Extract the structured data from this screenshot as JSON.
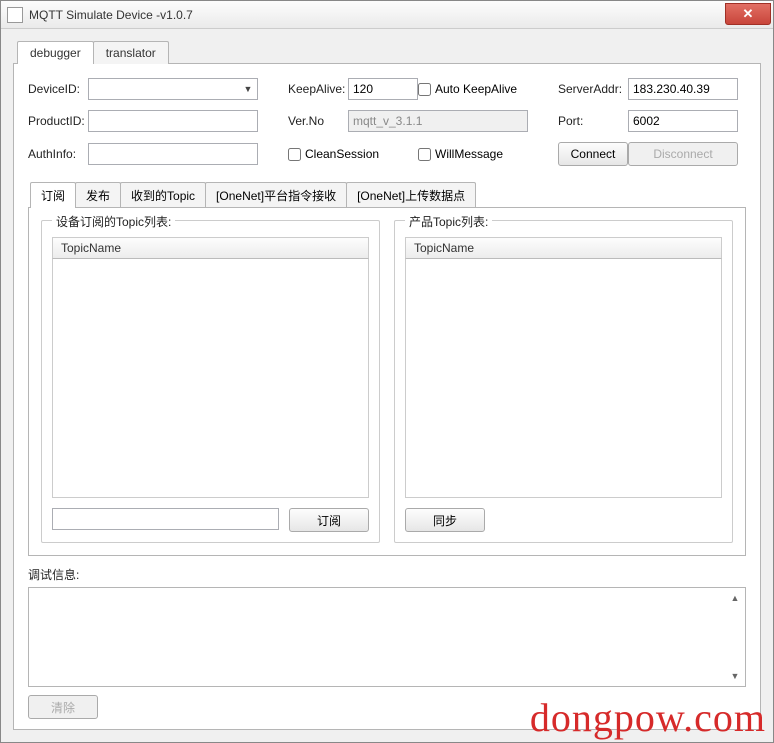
{
  "window": {
    "title": "MQTT Simulate Device  -v1.0.7"
  },
  "topTabs": {
    "debugger": "debugger",
    "translator": "translator"
  },
  "conn": {
    "deviceIdLabel": "DeviceID:",
    "deviceIdValue": "",
    "productIdLabel": "ProductID:",
    "productIdValue": "",
    "authInfoLabel": "AuthInfo:",
    "authInfoValue": "",
    "keepAliveLabel": "KeepAlive:",
    "keepAliveValue": "120",
    "autoKeepAliveLabel": "Auto KeepAlive",
    "verNoLabel": "Ver.No",
    "verNoValue": "mqtt_v_3.1.1",
    "cleanSessionLabel": "CleanSession",
    "willMessageLabel": "WillMessage",
    "serverAddrLabel": "ServerAddr:",
    "serverAddrValue": "183.230.40.39",
    "portLabel": "Port:",
    "portValue": "6002",
    "connectLabel": "Connect",
    "disconnectLabel": "Disconnect"
  },
  "innerTabs": {
    "subscribe": "订阅",
    "publish": "发布",
    "receivedTopic": "收到的Topic",
    "onenetCmd": "[OneNet]平台指令接收",
    "onenetUpload": "[OneNet]上传数据点"
  },
  "subscribePanel": {
    "deviceTopicListTitle": "设备订阅的Topic列表:",
    "productTopicListTitle": "产品Topic列表:",
    "topicNameHeader": "TopicName",
    "subscribeInput": "",
    "subscribeBtn": "订阅",
    "syncBtn": "同步"
  },
  "debug": {
    "label": "调试信息:",
    "clearBtn": "清除"
  },
  "watermark": "dongpow.com"
}
